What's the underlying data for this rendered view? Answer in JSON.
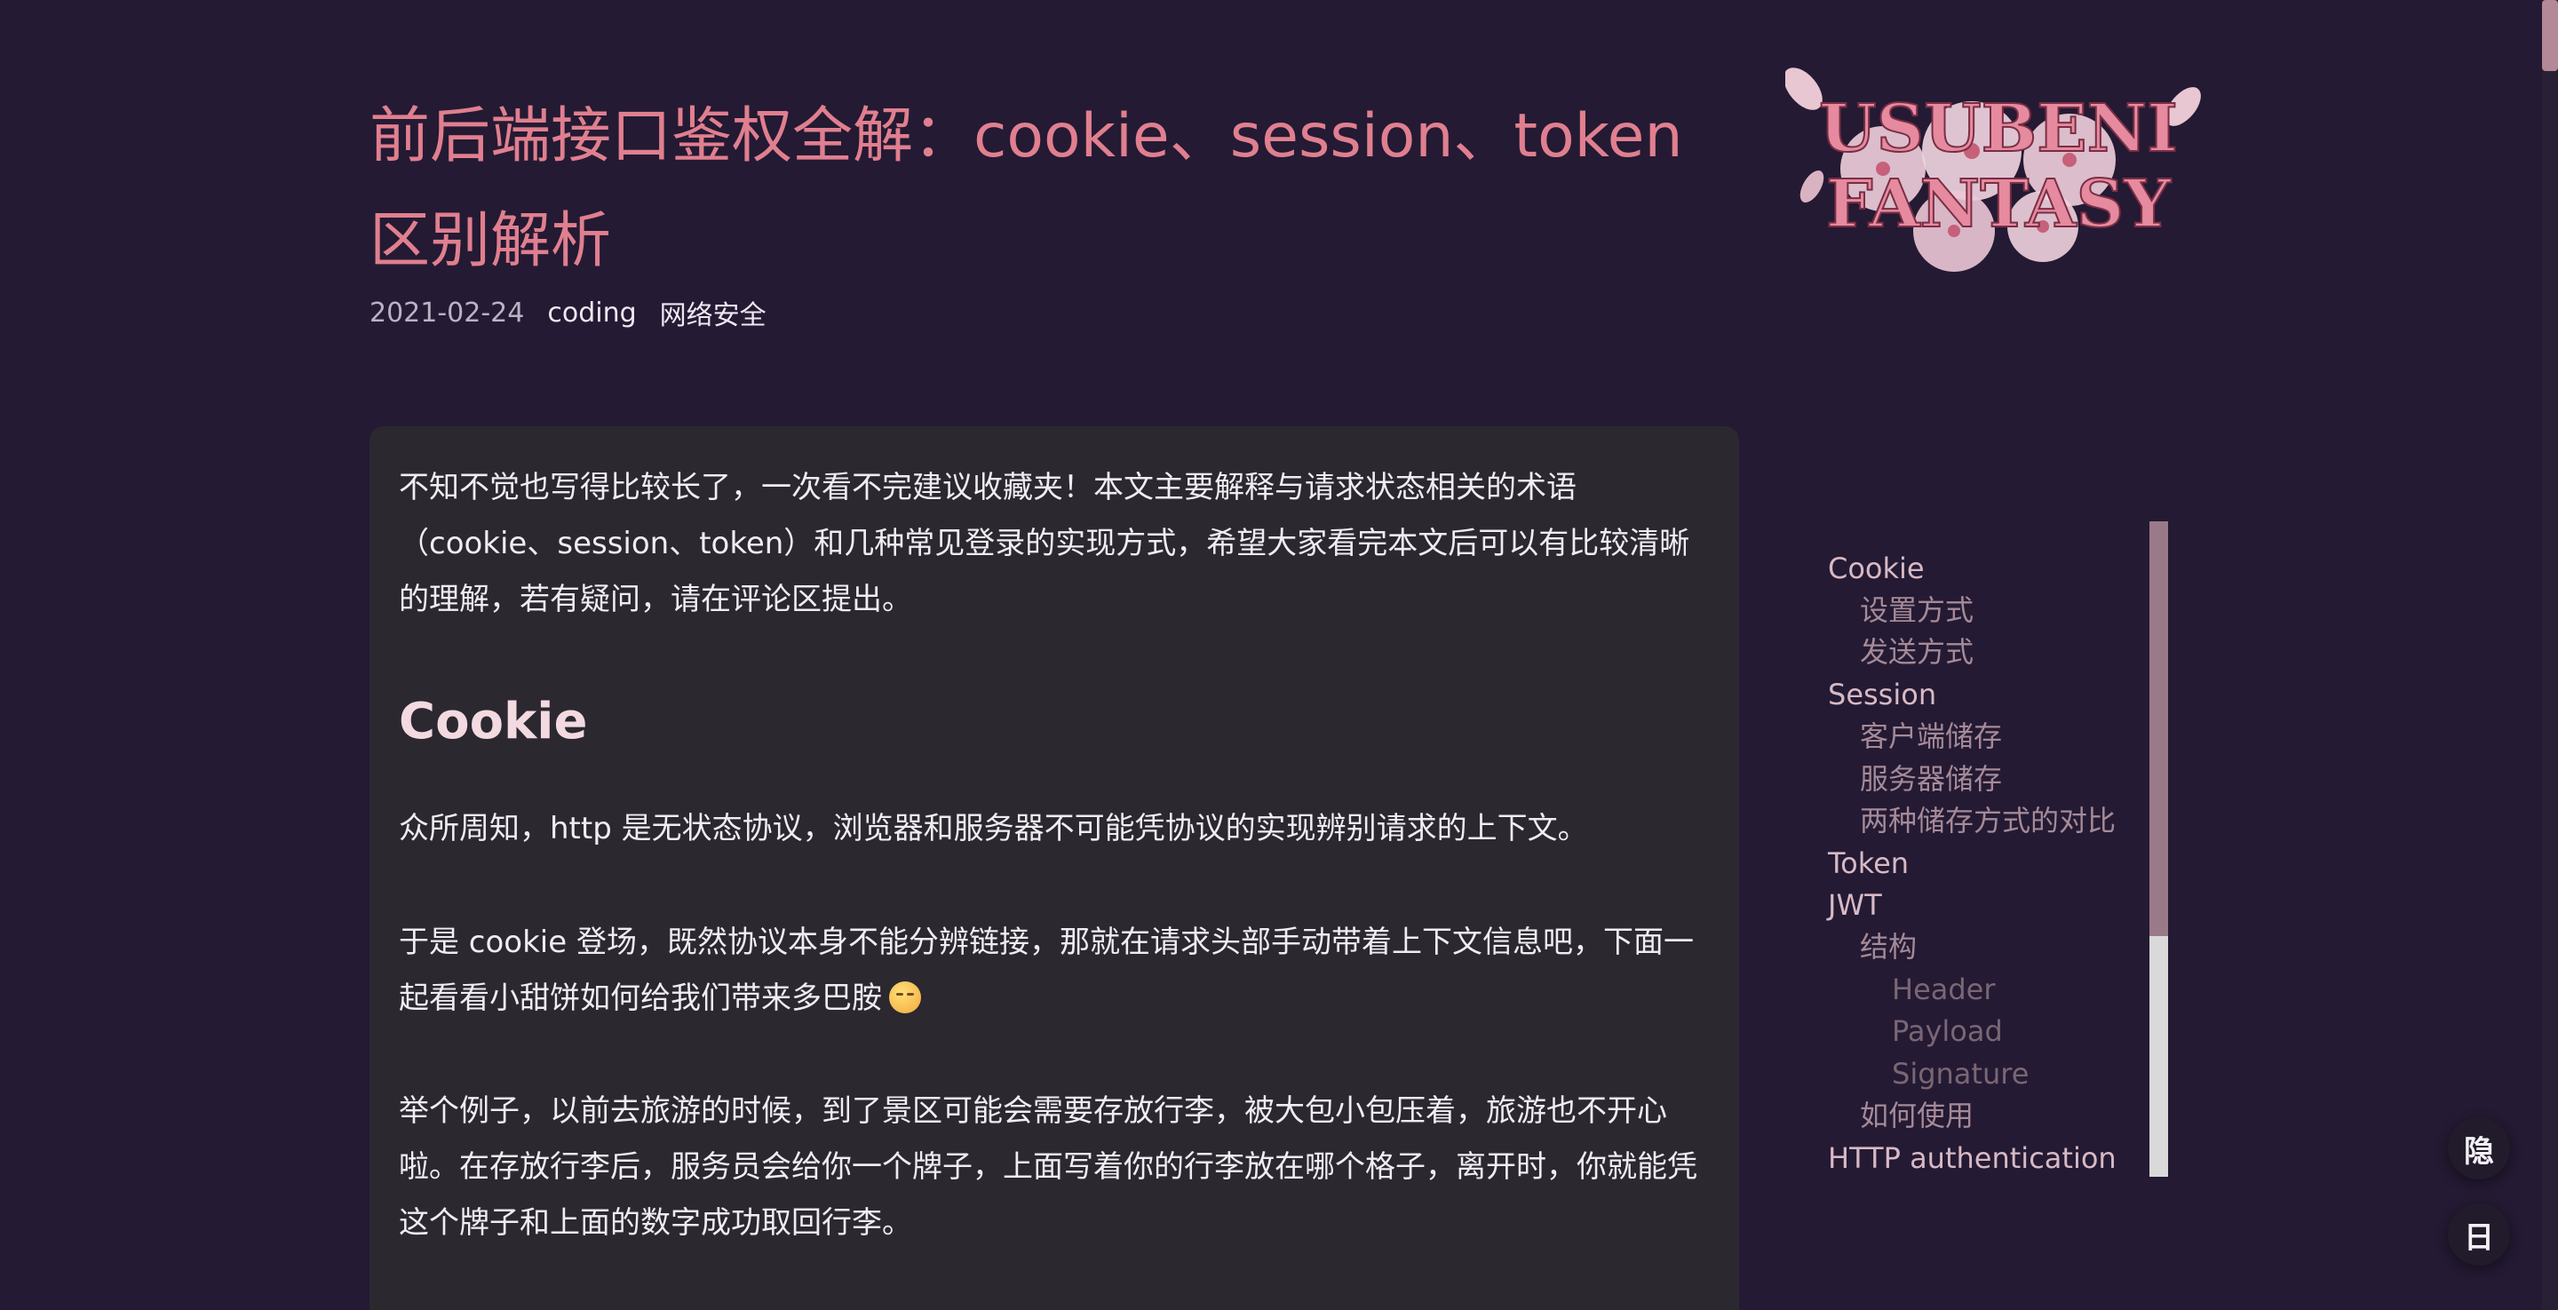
{
  "article": {
    "title": "前后端接口鉴权全解：cookie、session、token 区别解析",
    "date": "2021-02-24",
    "tags": [
      "coding",
      "网络安全"
    ]
  },
  "logo": {
    "line1": "USUBENI",
    "line2": "FANTASY"
  },
  "content": {
    "intro": "不知不觉也写得比较长了，一次看不完建议收藏夹！本文主要解释与请求状态相关的术语（cookie、session、token）和几种常见登录的实现方式，希望大家看完本文后可以有比较清晰的理解，若有疑问，请在评论区提出。",
    "heading_cookie": "Cookie",
    "p_http": "众所周知，http 是无状态协议，浏览器和服务器不可能凭协议的实现辨别请求的上下文。",
    "p_cookie": "于是 cookie 登场，既然协议本身不能分辨链接，那就在请求头部手动带着上下文信息吧，下面一起看看小甜饼如何给我们带来多巴胺",
    "p_example": "举个例子，以前去旅游的时候，到了景区可能会需要存放行李，被大包小包压着，旅游也不开心啦。在存放行李后，服务员会给你一个牌子，上面写着你的行李放在哪个格子，离开时，你就能凭这个牌子和上面的数字成功取回行李。"
  },
  "toc": {
    "items": [
      {
        "label": "Cookie",
        "level": 1
      },
      {
        "label": "设置方式",
        "level": 2
      },
      {
        "label": "发送方式",
        "level": 2
      },
      {
        "label": "Session",
        "level": 1
      },
      {
        "label": "客户端储存",
        "level": 2
      },
      {
        "label": "服务器储存",
        "level": 2
      },
      {
        "label": "两种储存方式的对比",
        "level": 2
      },
      {
        "label": "Token",
        "level": 1
      },
      {
        "label": "JWT",
        "level": 1
      },
      {
        "label": "结构",
        "level": 2
      },
      {
        "label": "Header",
        "level": 3
      },
      {
        "label": "Payload",
        "level": 3
      },
      {
        "label": "Signature",
        "level": 3
      },
      {
        "label": "如何使用",
        "level": 2
      },
      {
        "label": "HTTP authentication",
        "level": 1
      }
    ]
  },
  "buttons": {
    "hide": "隐",
    "day": "日"
  },
  "colors": {
    "background": "#241a33",
    "title": "#e07f8f",
    "card": "#2b2830"
  }
}
